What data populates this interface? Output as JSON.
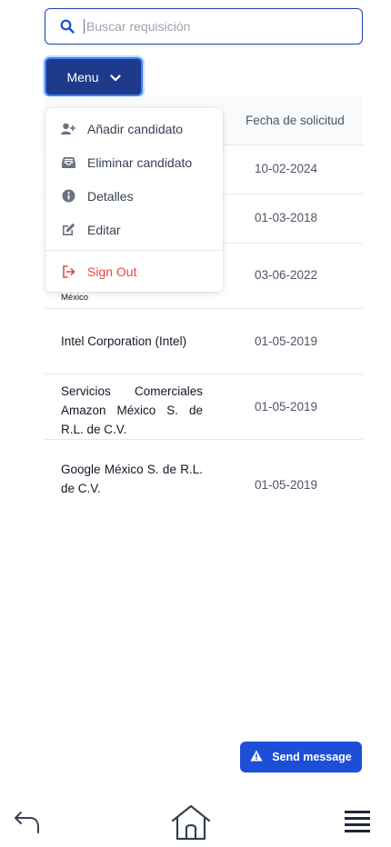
{
  "search": {
    "placeholder": "Buscar requisición",
    "value": ""
  },
  "menu_button": {
    "label": "Menu"
  },
  "dropdown": {
    "items": [
      {
        "label": "Añadir candidato",
        "icon": "user-plus-icon"
      },
      {
        "label": "Eliminar candidato",
        "icon": "inbox-tray-icon"
      },
      {
        "label": "Detalles",
        "icon": "info-icon"
      },
      {
        "label": "Editar",
        "icon": "edit-icon"
      }
    ],
    "signout": {
      "label": "Sign Out",
      "icon": "sign-out-icon",
      "color": "#ef4444"
    }
  },
  "table": {
    "header_date": "Fecha de solicitud",
    "rows": [
      {
        "company": "",
        "date": "10-02-2024"
      },
      {
        "company": "",
        "date": "01-03-2018"
      },
      {
        "company": "México",
        "date": "03-06-2022"
      },
      {
        "company": "Intel Corporation (Intel)",
        "date": "01-05-2019"
      },
      {
        "company": "Servicios Comerciales Amazon México S. de R.L. de C.V.",
        "date": "01-05-2019"
      },
      {
        "company": "Google México S. de R.L. de C.V.",
        "date": "01-05-2019"
      }
    ]
  },
  "send_message": {
    "label": "Send message",
    "icon": "warning-icon"
  },
  "bottom_nav": {
    "back_icon": "back-arrow-icon",
    "home_icon": "home-icon",
    "menu_icon": "hamburger-menu-icon"
  },
  "colors": {
    "primary": "#1e3a8a",
    "accent": "#1d4ed8",
    "danger": "#ef4444",
    "border": "#e5e7eb"
  }
}
